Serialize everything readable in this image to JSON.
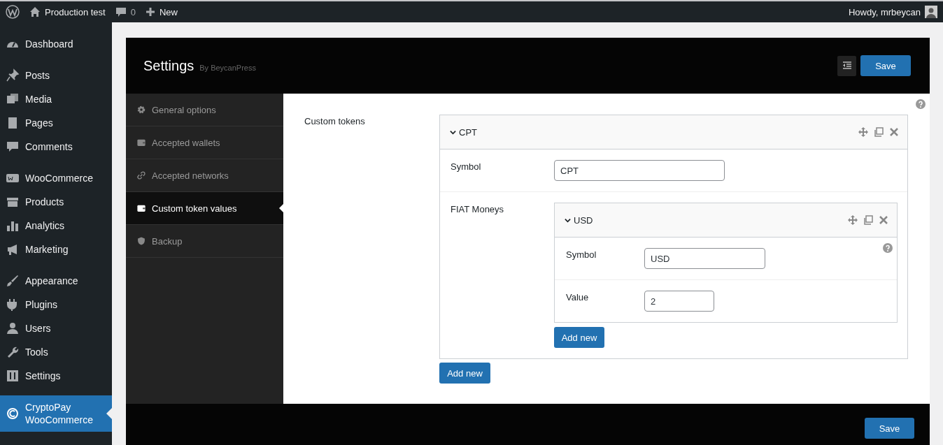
{
  "admin_bar": {
    "site": "Production test",
    "comments": "0",
    "new": "New",
    "greeting": "Howdy, mrbeycan"
  },
  "sidebar": {
    "groups": [
      {
        "items": [
          {
            "label": "Dashboard",
            "selected": false
          }
        ]
      },
      {
        "items": [
          {
            "label": "Posts",
            "selected": false
          },
          {
            "label": "Media",
            "selected": false
          },
          {
            "label": "Pages",
            "selected": false
          },
          {
            "label": "Comments",
            "selected": false
          }
        ]
      },
      {
        "items": [
          {
            "label": "WooCommerce",
            "selected": false
          },
          {
            "label": "Products",
            "selected": false
          },
          {
            "label": "Analytics",
            "selected": false
          },
          {
            "label": "Marketing",
            "selected": false
          }
        ]
      },
      {
        "items": [
          {
            "label": "Appearance",
            "selected": false
          },
          {
            "label": "Plugins",
            "selected": false
          },
          {
            "label": "Users",
            "selected": false
          },
          {
            "label": "Tools",
            "selected": false
          },
          {
            "label": "Settings",
            "selected": false
          }
        ]
      },
      {
        "items": [
          {
            "label": "CryptoPay WooCommerce",
            "selected": true
          }
        ]
      }
    ]
  },
  "settings": {
    "title": "Settings",
    "subtitle": "By BeycanPress",
    "save": "Save",
    "nav": [
      {
        "label": "General options",
        "selected": false
      },
      {
        "label": "Accepted wallets",
        "selected": false
      },
      {
        "label": "Accepted networks",
        "selected": false
      },
      {
        "label": "Custom token values",
        "selected": true
      },
      {
        "label": "Backup",
        "selected": false
      }
    ],
    "field_label": "Custom tokens",
    "tokens": [
      {
        "title": "CPT",
        "expanded": true,
        "fields": [
          {
            "label": "Symbol",
            "value": "CPT"
          }
        ],
        "fiat": {
          "label": "FIAT Moneys",
          "add": "Add new",
          "items": [
            {
              "title": "USD",
              "expanded": true,
              "fields": [
                {
                  "label": "Symbol",
                  "value": "USD"
                },
                {
                  "label": "Value",
                  "value": "2"
                }
              ]
            }
          ]
        }
      }
    ],
    "add": "Add new",
    "footer_save": "Save"
  }
}
